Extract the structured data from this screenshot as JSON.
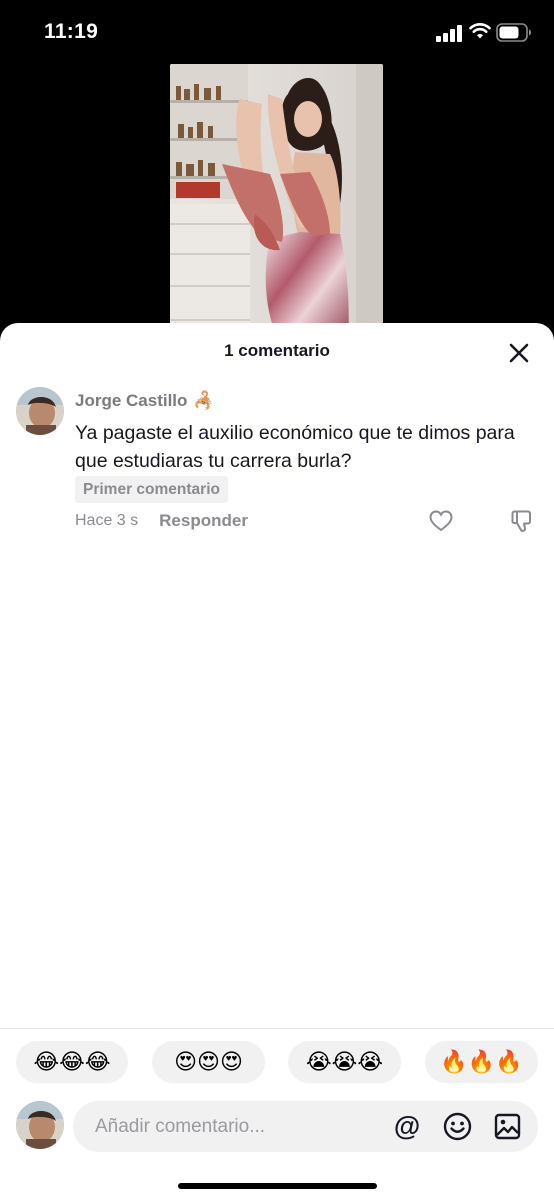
{
  "status_bar": {
    "time": "11:19"
  },
  "sheet": {
    "title": "1 comentario",
    "close_icon": "close-icon"
  },
  "comment": {
    "username": "Jorge Castillo",
    "username_badge_icon": "scorpion-emoji-icon",
    "text": "Ya pagaste el auxilio económico que te dimos para que estudiaras tu carrera burla?",
    "badge": "Primer comentario",
    "time": "Hace 3 s",
    "reply_label": "Responder",
    "like_icon": "heart-outline-icon",
    "dislike_icon": "thumbs-down-icon"
  },
  "emoji_bar": [
    {
      "label": "😂😂😂",
      "name": "laughing"
    },
    {
      "label": "😍😍😍",
      "name": "heart-eyes"
    },
    {
      "label": "😭😭😭",
      "name": "crying"
    },
    {
      "label": "🔥🔥🔥",
      "name": "fire"
    }
  ],
  "composer": {
    "placeholder": "Añadir comentario...",
    "mention_label": "@",
    "emoji_icon": "smiley-icon",
    "image_icon": "image-icon"
  },
  "colors": {
    "text_primary": "#161823",
    "text_secondary": "#8a8b91",
    "surface_gray": "#f1f1f2",
    "background_dark": "#000000"
  }
}
